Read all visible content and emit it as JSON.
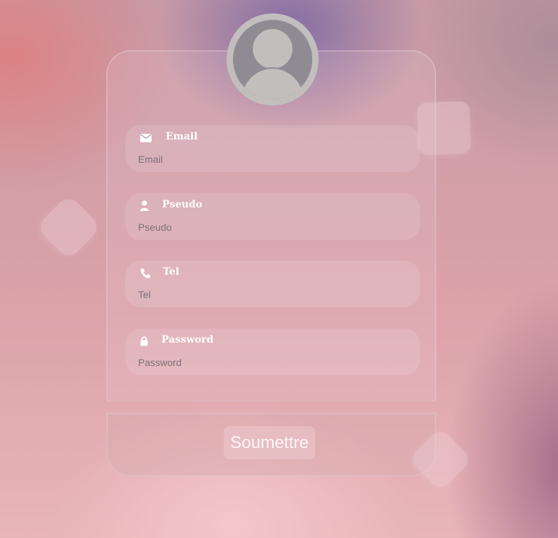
{
  "form": {
    "fields": [
      {
        "id": "email",
        "label": "Email",
        "placeholder": "Email",
        "value": "",
        "icon": "envelope-icon"
      },
      {
        "id": "pseudo",
        "label": "Pseudo",
        "placeholder": "Pseudo",
        "value": "",
        "icon": "user-icon"
      },
      {
        "id": "tel",
        "label": "Tel",
        "placeholder": "Tel",
        "value": "",
        "icon": "phone-icon"
      },
      {
        "id": "password",
        "label": "Password",
        "placeholder": "Password",
        "value": "",
        "icon": "lock-icon"
      }
    ],
    "submit_label": "Soumettre"
  },
  "avatar": {
    "icon": "user-avatar-icon"
  },
  "colors": {
    "avatar_bg": "#c2bebe",
    "avatar_silhouette": "#8e8b93",
    "label_text": "#ffffff",
    "placeholder_text": "#7d7079"
  }
}
